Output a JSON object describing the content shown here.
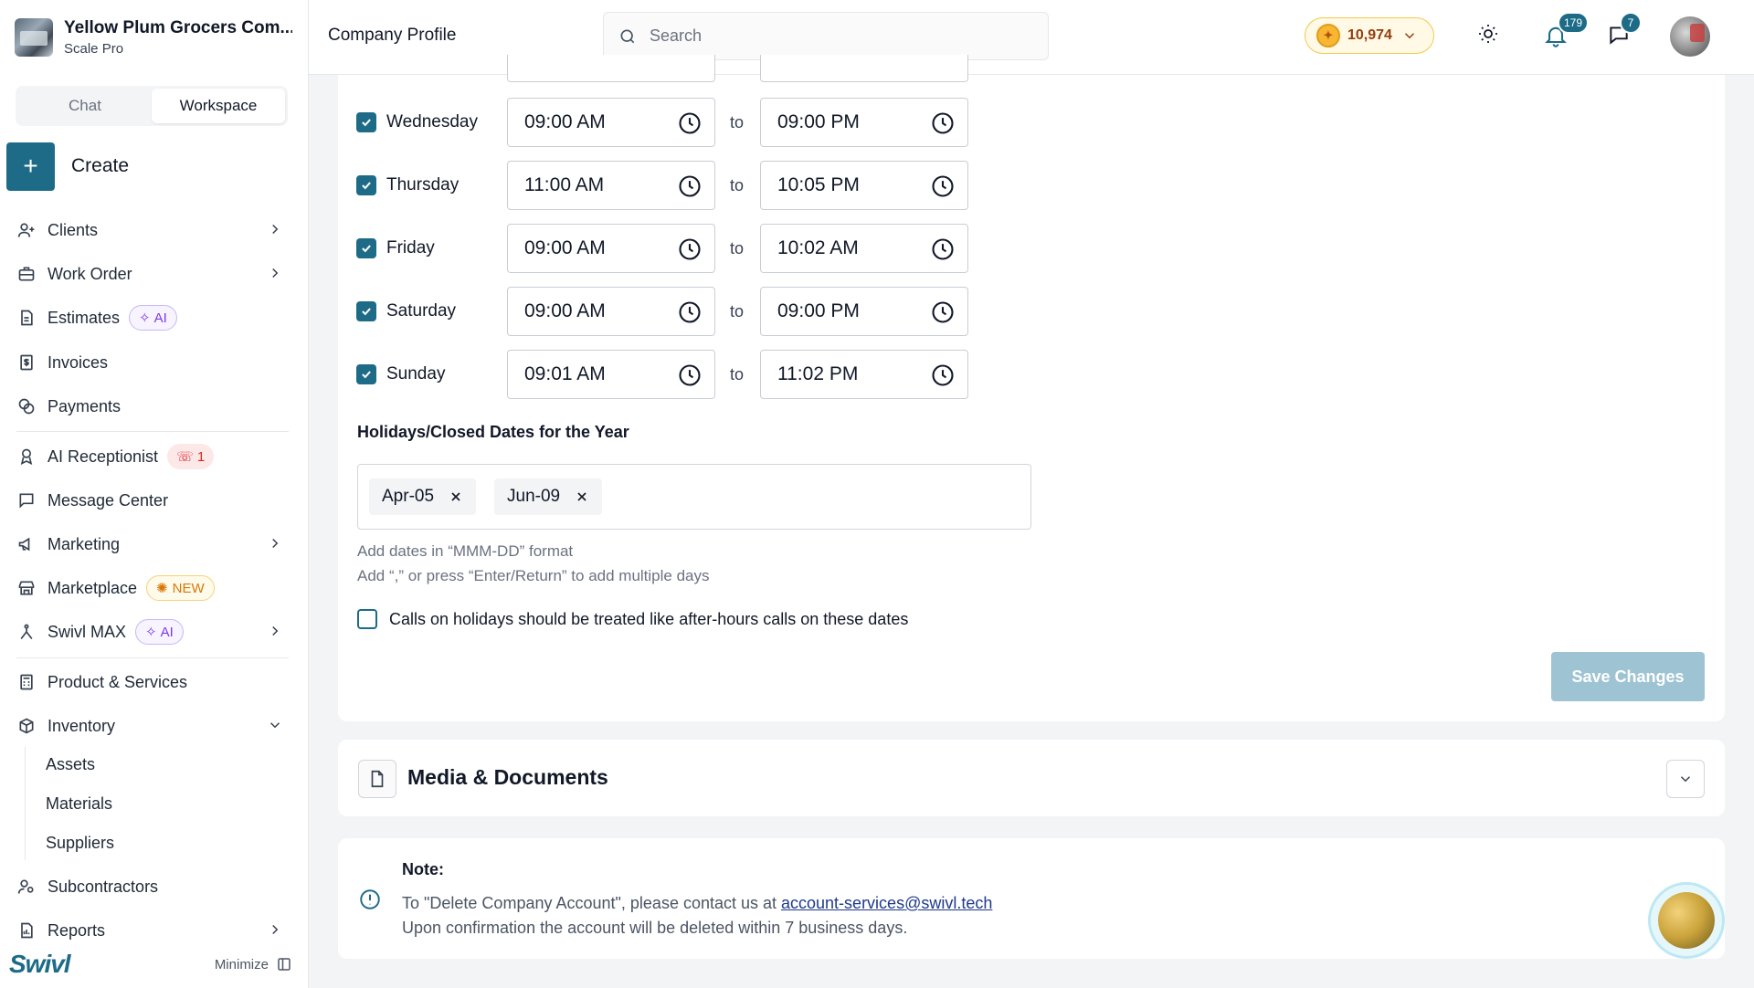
{
  "sidebar": {
    "company_name": "Yellow Plum Grocers Com...",
    "company_plan": "Scale Pro",
    "tabs": [
      "Chat",
      "Workspace"
    ],
    "active_tab": "Workspace",
    "create_label": "Create",
    "items": {
      "clients": "Clients",
      "work_order": "Work Order",
      "estimates": "Estimates",
      "estimates_badge": "AI",
      "invoices": "Invoices",
      "payments": "Payments",
      "ai_receptionist": "AI Receptionist",
      "ai_receptionist_badge": "1",
      "message_center": "Message Center",
      "marketing": "Marketing",
      "marketplace": "Marketplace",
      "marketplace_badge": "NEW",
      "swivl_max": "Swivl MAX",
      "swivl_max_badge": "AI",
      "product_services": "Product & Services",
      "inventory": "Inventory",
      "assets": "Assets",
      "materials": "Materials",
      "suppliers": "Suppliers",
      "subcontractors": "Subcontractors",
      "reports": "Reports"
    },
    "brand": "Swivl",
    "minimize_label": "Minimize"
  },
  "header": {
    "title": "Company Profile",
    "search_placeholder": "Search",
    "credits": "10,974",
    "notifications_count": "179",
    "messages_count": "7"
  },
  "hours": {
    "to_label": "to",
    "days": [
      {
        "day": "Wednesday",
        "checked": true,
        "open": "09:00 AM",
        "close": "09:00 PM"
      },
      {
        "day": "Thursday",
        "checked": true,
        "open": "11:00 AM",
        "close": "10:05 PM"
      },
      {
        "day": "Friday",
        "checked": true,
        "open": "09:00 AM",
        "close": "10:02 AM"
      },
      {
        "day": "Saturday",
        "checked": true,
        "open": "09:00 AM",
        "close": "09:00 PM"
      },
      {
        "day": "Sunday",
        "checked": true,
        "open": "09:01 AM",
        "close": "11:02 PM"
      }
    ]
  },
  "holidays": {
    "heading": "Holidays/Closed Dates for the Year",
    "tags": [
      "Apr-05",
      "Jun-09"
    ],
    "hint_format": "Add dates in “MMM-DD” format",
    "hint_multiple": "Add “,” or press “Enter/Return” to add multiple days",
    "after_hours_label": "Calls on holidays should be treated like after-hours calls on these dates",
    "after_hours_checked": false
  },
  "save_label": "Save Changes",
  "media": {
    "title": "Media & Documents"
  },
  "note": {
    "title": "Note:",
    "line1_prefix": "To \"Delete Company Account\", please contact us at ",
    "email": "account-services@swivl.tech",
    "line2": "Upon confirmation the account will be deleted within 7 business days."
  },
  "colors": {
    "accent": "#1d6b87",
    "save_disabled": "#9ec3d2",
    "ai_badge": "#7c3aed",
    "call_badge": "#dc2626",
    "new_badge": "#d97706"
  }
}
